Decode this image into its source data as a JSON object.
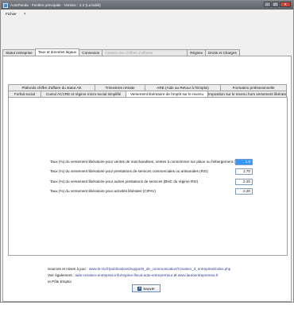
{
  "window": {
    "title": "AutoPanda - Fenêtre principale  -  Version : 2.2 (La build)",
    "controls": {
      "minimize": "–",
      "maximize": "□",
      "close": "✕"
    }
  },
  "menu": {
    "items": [
      "Fichier",
      "?"
    ]
  },
  "tabs": [
    {
      "label": "Statut entreprise",
      "state": "normal"
    },
    {
      "label": "Taux et données légaux",
      "state": "active"
    },
    {
      "label": "Connexion",
      "state": "normal"
    },
    {
      "label": "Gestion des chiffres d'affaires",
      "state": "disabled"
    },
    {
      "label": "Régime",
      "state": "normal"
    },
    {
      "label": "Droits et Charges",
      "state": "normal"
    }
  ],
  "inner_tabs_row1": [
    "Plafonds chiffre d'affaire du statut AE",
    "Trimestres retraite",
    "ARE (Aide au Retour à l'Emploi)",
    "Formation professionnelle"
  ],
  "inner_tabs_row2": [
    "Forfait social",
    "Cumul ACCRE et régime micro-social simplifié",
    "Versement libératoire de l'impôt sur le revenu",
    "Imposition sur le revenu hors versement libératoire"
  ],
  "rates": [
    {
      "label": "Taux (%) du versement libératoire pour ventes de marchandises, ventes à consommer sur place ou hébergement  (RSI)",
      "value": "1.0",
      "selected": true
    },
    {
      "label": "Taux (%) du versement libératoire pour prestations de services commerciales ou artisanales (RSI)",
      "value": "1.70",
      "selected": false
    },
    {
      "label": "Taux (%) du versement libératoire pour autres prestations de services (BNC du régime RSI)",
      "value": "2.20",
      "selected": false
    },
    {
      "label": "Taux (%) du versement libératoire pour activités libérales (CIPAV)",
      "value": "2.20",
      "selected": false
    }
  ],
  "sources": {
    "line1_prefix": "Sources et mises à jour :",
    "line1_link": "www.le-rsi.fr/publications/supports_de_communication/Creation_d_entreprise/index.php",
    "line2_prefix": "Voir également :",
    "line2_link1": "aide-creation-entreprise.info/regime-fiscal-auto-entrepreneur",
    "line2_and": "et",
    "line2_link2": "www.lautoentrepreneur.fr",
    "line3": "et Pôle Emploi"
  },
  "save_label": "Sauver"
}
